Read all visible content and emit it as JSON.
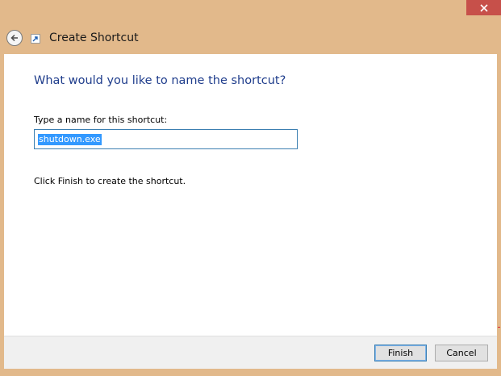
{
  "window": {
    "title": "Create Shortcut",
    "close_label": "✕"
  },
  "page": {
    "heading": "What would you like to name the shortcut?",
    "field_label": "Type a name for this shortcut:",
    "name_value": "shutdown.exe",
    "instruction": "Click Finish to create the shortcut."
  },
  "buttons": {
    "finish": "Finish",
    "cancel": "Cancel"
  },
  "icons": {
    "back": "back-arrow-icon",
    "shortcut": "shortcut-icon",
    "close": "close-icon"
  },
  "colors": {
    "frame": "#e2b98b",
    "close": "#c7504a",
    "heading": "#1f3d8c",
    "selection": "#3399ff",
    "input_border": "#3c7fb1"
  }
}
